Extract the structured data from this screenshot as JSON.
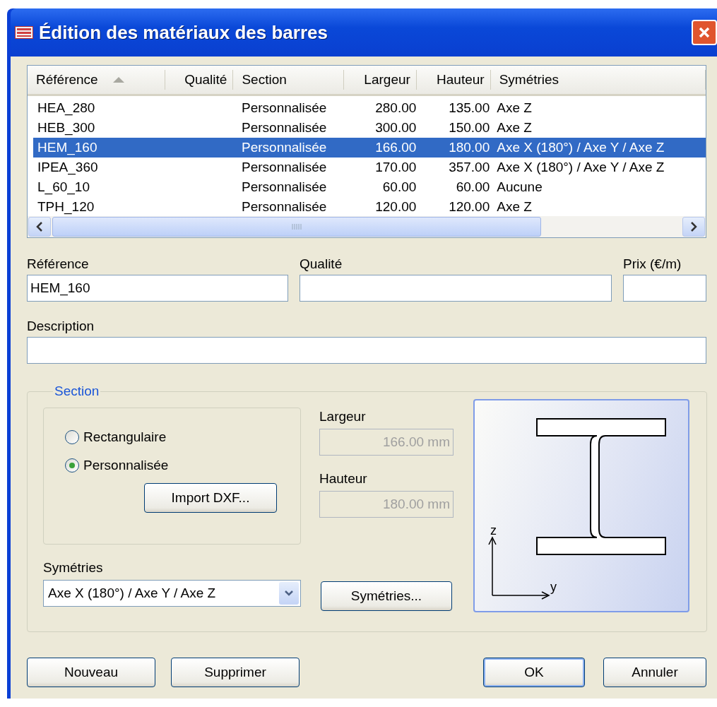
{
  "window": {
    "title": "Édition des matériaux des barres"
  },
  "table": {
    "columns": [
      {
        "label": "Référence",
        "sorted": true
      },
      {
        "label": "Qualité",
        "sorted": false
      },
      {
        "label": "Section",
        "sorted": false
      },
      {
        "label": "Largeur",
        "sorted": false
      },
      {
        "label": "Hauteur",
        "sorted": false
      },
      {
        "label": "Symétries",
        "sorted": false
      }
    ],
    "rows": [
      {
        "cells": [
          "HEA_280",
          "",
          "Personnalisée",
          "280.00",
          "135.00",
          "Axe Z"
        ],
        "selected": false
      },
      {
        "cells": [
          "HEB_300",
          "",
          "Personnalisée",
          "300.00",
          "150.00",
          "Axe Z"
        ],
        "selected": false
      },
      {
        "cells": [
          "HEM_160",
          "",
          "Personnalisée",
          "166.00",
          "180.00",
          "Axe X (180°) / Axe Y / Axe Z"
        ],
        "selected": true
      },
      {
        "cells": [
          "IPEA_360",
          "",
          "Personnalisée",
          "170.00",
          "357.00",
          "Axe X (180°) / Axe Y / Axe Z"
        ],
        "selected": false
      },
      {
        "cells": [
          "L_60_10",
          "",
          "Personnalisée",
          "60.00",
          "60.00",
          "Aucune"
        ],
        "selected": false
      },
      {
        "cells": [
          "TPH_120",
          "",
          "Personnalisée",
          "120.00",
          "120.00",
          "Axe Z"
        ],
        "selected": false
      }
    ]
  },
  "fields": {
    "reference": {
      "label": "Référence",
      "value": "HEM_160"
    },
    "quality": {
      "label": "Qualité"
    },
    "price": {
      "label": "Prix (€/m)"
    },
    "description": {
      "label": "Description"
    }
  },
  "section": {
    "title": "Section",
    "options": [
      {
        "label": "Rectangulaire",
        "selected": false
      },
      {
        "label": "Personnalisée",
        "selected": true
      }
    ],
    "import_button": "Import DXF...",
    "width": {
      "label": "Largeur",
      "value": "166.00 mm",
      "disabled": true
    },
    "height": {
      "label": "Hauteur",
      "value": "180.00 mm",
      "disabled": true
    },
    "symmetries": {
      "label": "Symétries",
      "value": "Axe X (180°) / Axe Y / Axe Z"
    },
    "symmetries_button": "Symétries...",
    "axis_labels": [
      "z",
      "y"
    ]
  },
  "buttons": {
    "left": [
      "Nouveau",
      "Supprimer"
    ],
    "right": [
      "OK",
      "Annuler"
    ]
  }
}
